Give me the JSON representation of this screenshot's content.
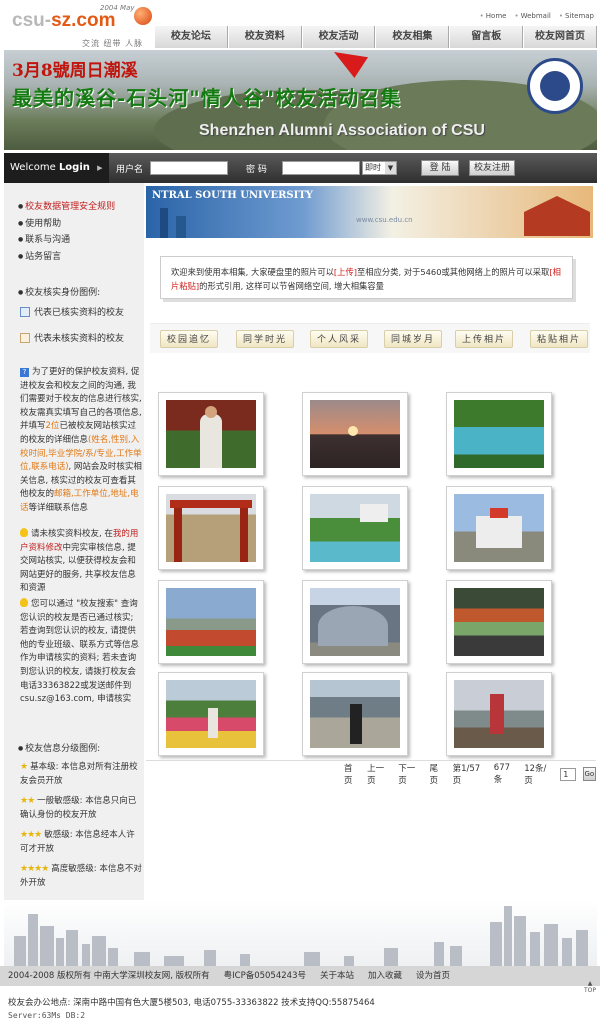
{
  "header": {
    "logo_date": "2004 May",
    "logo_name_a": "csu-",
    "logo_name_b": "sz.com",
    "logo_slogan": "交流 纽带 人脉",
    "top_links": [
      "Home",
      "Webmail",
      "Sitemap"
    ],
    "nav": [
      "校友论坛",
      "校友资料",
      "校友活动",
      "校友相集",
      "留言板",
      "校友网首页"
    ]
  },
  "banner": {
    "line1": "3月8號周日潮溪",
    "line2": "最美的溪谷-石头河\"情人谷\"校友活动召集",
    "line3": "Shenzhen Alumni Association of CSU"
  },
  "login": {
    "welcome_prefix": "Welcome",
    "welcome_bold": "Login",
    "arrow": "▶",
    "username_label": "用户名",
    "password_label": "密  码",
    "session_select": "即时",
    "login_button": "登 陆",
    "register_button": "校友注册"
  },
  "sidebar": {
    "links": [
      "校友数据管理安全规则",
      "使用帮助",
      "联系与沟通",
      "站务留言"
    ],
    "legend_title": "校友核实身份图例:",
    "legend_verified": "代表已核实资料的校友",
    "legend_unverified": "代表未核实资料的校友",
    "para1_a": "为了更好的保护校友资料, 促进校友会和校友之间的沟通, 我们需要对于校友的信息进行核实, 校友需真实填写自己的各项信息, 并填写",
    "para1_b": "2位",
    "para1_c": "已被校友网站核实过的校友的详细信息",
    "para1_d": "(姓名,性别,入校时间,毕业学院/系/专业,工作单位,联系电话)",
    "para1_e": ", 网站会及时核实相关信息, 核实过的校友可查看其他校友的",
    "para1_f": "邮箱,工作单位,地址,电话",
    "para1_g": "等详细联系信息",
    "para2_a": "请未核实资料校友, 在",
    "para2_b": "我的用户资料修改",
    "para2_c": "中完实审核信息, 提交网站核实, 以便获得校友会和网站更好的服务, 共享校友信息和资源",
    "para3": "您可以通过 \"校友搜索\" 查询您认识的校友是否已通过核实; 若查询到您认识的校友, 请提供他的专业班级、联系方式等信息作为申请核实的资料; 若未查询到您认识的校友, 请拨打校友会电话33363822或发送邮件到csu.sz@163.com, 申请核实",
    "level_title": "校友信息分级图例:",
    "level1": "基本级: 本信息对所有注册校友会员开放",
    "level2": "一般敏感级: 本信息只向已确认身份的校友开放",
    "level3": "敏感级: 本信息经本人许可才开放",
    "level4": "高度敏感级: 本信息不对外开放"
  },
  "main": {
    "top_image_text": "NTRAL SOUTH UNIVERSITY",
    "top_image_url": "www.csu.edu.cn",
    "notice_a": "欢迎来到使用本相集, 大家硬盘里的照片可以",
    "notice_b": "[上传]",
    "notice_c": "至相应分类, 对于5460或其他网络上的照片可以采取",
    "notice_d": "[相片粘贴]",
    "notice_e": "的形式引用, 这样可以节省网络空间, 增大相集容量",
    "tabs": [
      "校园追忆",
      "同学时光",
      "个人风采",
      "同城岁月",
      "上传相片",
      "粘贴相片"
    ],
    "pager": {
      "first": "首页",
      "prev": "上一页",
      "next": "下一页",
      "last": "尾页",
      "page_info": "第1/57页",
      "count": "677条",
      "per_page": "12条/页",
      "page_input": "1",
      "go": "Go"
    }
  },
  "footer": {
    "copyright": "2004-2008 版权所有  中南大学深圳校友网, 版权所有",
    "icp": "粤ICP备05054243号",
    "about": "关于本站",
    "fav": "加入收藏",
    "home": "设为首页",
    "address": "校友会办公地点: 深南中路中国有色大厦5楼503, 电话0755-33363822    技术支持QQ:55875464",
    "server": "Server:63Ms  DB:2",
    "top": "TOP"
  },
  "colors": {
    "accent_red": "#c02020",
    "accent_orange": "#e07814",
    "nav_bg": "#d8d8d8",
    "login_bg": "#2f2f2f"
  }
}
